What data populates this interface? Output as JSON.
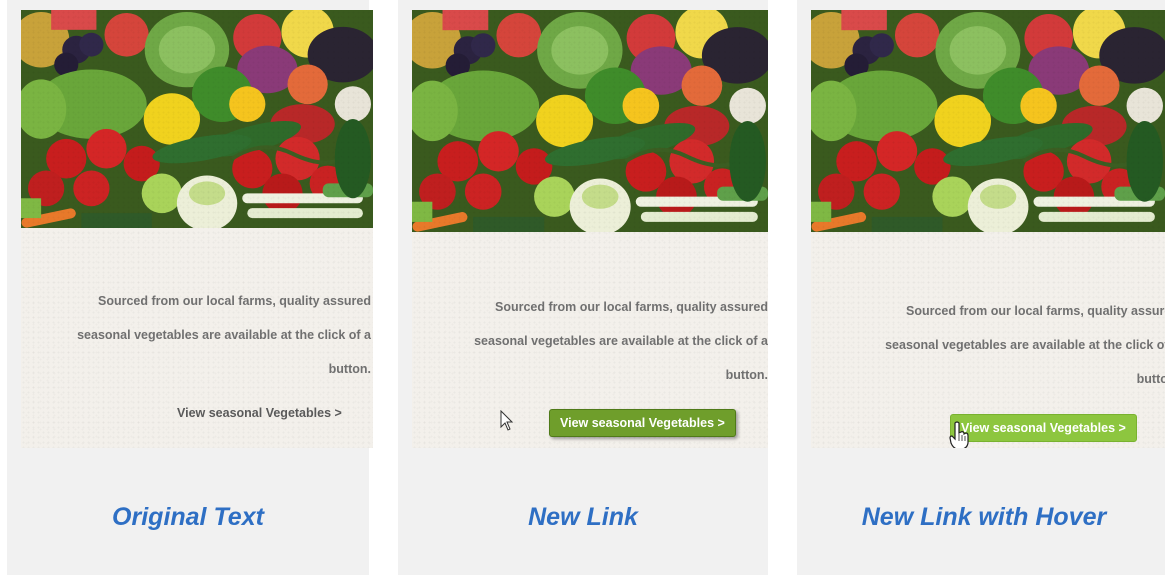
{
  "panels": [
    {
      "caption": "Original Text",
      "description_lines": [
        "Sourced from our local farms, quality assured",
        "seasonal vegetables are available at the click of a",
        "button."
      ],
      "link_label": "View seasonal Vegetables >"
    },
    {
      "caption": "New Link",
      "description_lines": [
        "Sourced from our local farms, quality assured",
        "seasonal vegetables are available at the click of a",
        "button."
      ],
      "link_label": "View seasonal Vegetables >"
    },
    {
      "caption": "New Link with Hover",
      "description_lines": [
        "Sourced from our local farms, quality assured",
        "seasonal vegetables are available at the click of a",
        "button."
      ],
      "link_label": "View seasonal Vegetables >"
    }
  ],
  "colors": {
    "caption": "#2e6fc4",
    "button_normal": "#6f9e2b",
    "button_hover": "#8dc63f",
    "body_text": "#707070"
  },
  "icons": [
    "vegetables-photo",
    "arrow-pointer-icon",
    "hand-pointer-icon"
  ]
}
